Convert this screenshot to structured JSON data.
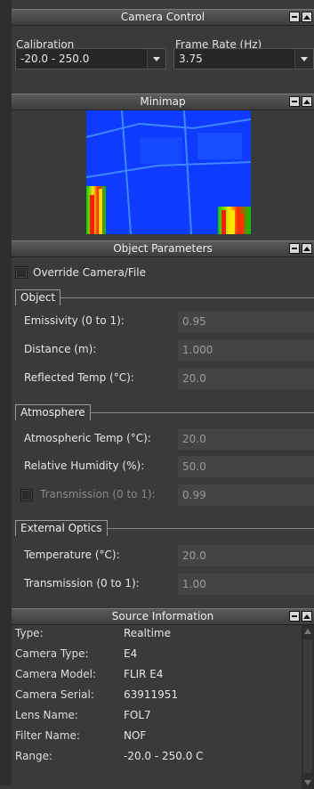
{
  "camera_control": {
    "title": "Camera Control",
    "calibration_label": "Calibration",
    "frame_rate_label": "Frame Rate (Hz)",
    "calibration_value": "-20.0 - 250.0",
    "frame_rate_value": "3.75"
  },
  "minimap": {
    "title": "Minimap"
  },
  "object_parameters": {
    "title": "Object Parameters",
    "override_label": "Override Camera/File",
    "object_group": {
      "title": "Object",
      "emissivity_label": "Emissivity (0 to 1):",
      "emissivity_value": "0.95",
      "distance_label": "Distance (m):",
      "distance_value": "1.000",
      "reflected_label": "Reflected Temp (°C):",
      "reflected_value": "20.0"
    },
    "atmosphere_group": {
      "title": "Atmosphere",
      "atm_temp_label": "Atmospheric Temp (°C):",
      "atm_temp_value": "20.0",
      "humidity_label": "Relative Humidity (%):",
      "humidity_value": "50.0",
      "transmission_label": "Transmission (0 to 1):",
      "transmission_value": "0.99"
    },
    "external_optics_group": {
      "title": "External Optics",
      "temperature_label": "Temperature (°C):",
      "temperature_value": "20.0",
      "transmission_label": "Transmission (0 to 1):",
      "transmission_value": "1.00"
    }
  },
  "source_information": {
    "title": "Source Information",
    "rows": [
      {
        "key": "Type:",
        "value": "Realtime"
      },
      {
        "key": "Camera Type:",
        "value": "E4"
      },
      {
        "key": "Camera Model:",
        "value": "FLIR E4"
      },
      {
        "key": "Camera Serial:",
        "value": "63911951"
      },
      {
        "key": "Lens Name:",
        "value": "FOL7"
      },
      {
        "key": "Filter Name:",
        "value": "NOF"
      },
      {
        "key": "Range:",
        "value": "-20.0 - 250.0 C"
      }
    ]
  }
}
